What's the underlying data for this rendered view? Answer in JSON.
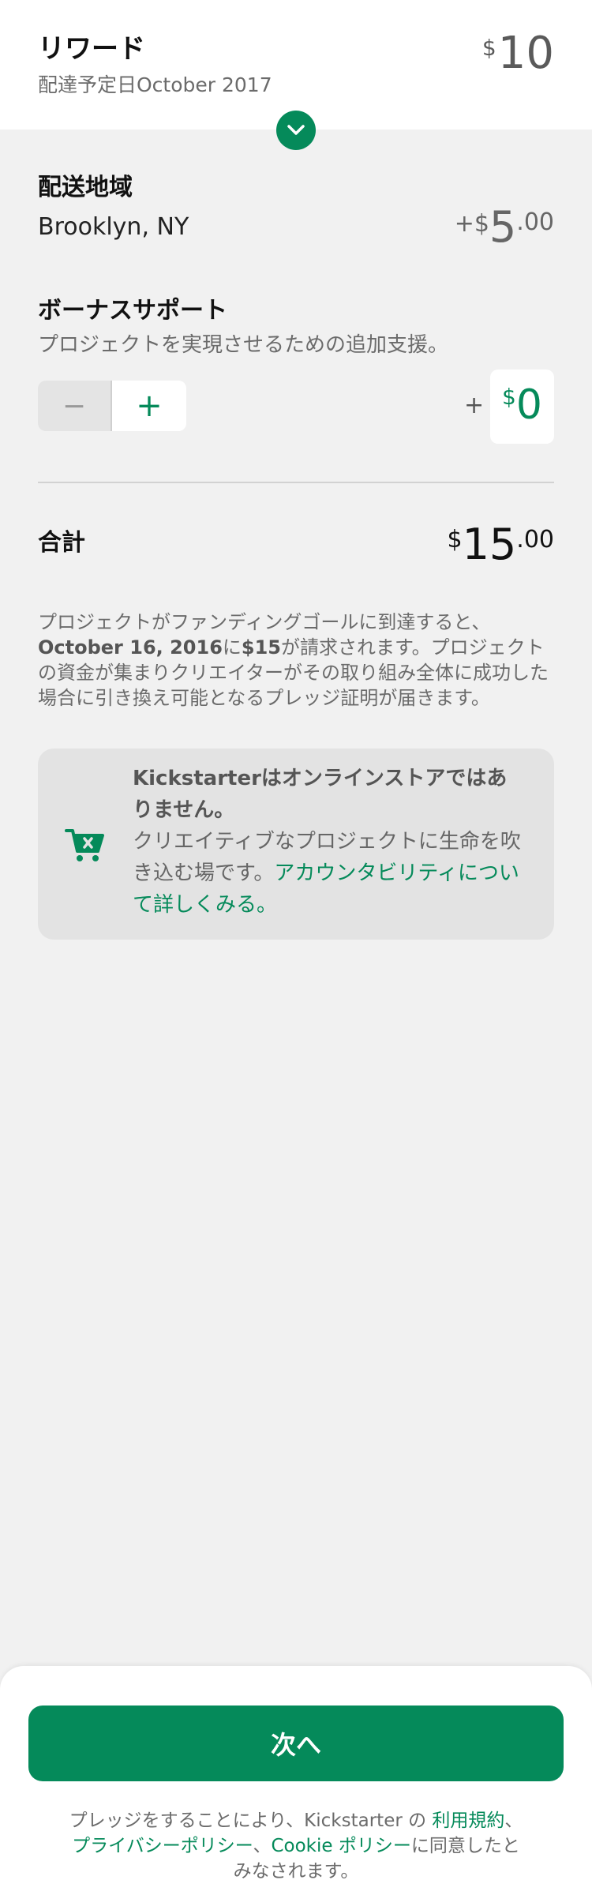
{
  "reward": {
    "title": "リワード",
    "delivery": "配達予定日October 2017",
    "currency": "$",
    "amount": "10"
  },
  "shipping": {
    "label": "配送地域",
    "location": "Brooklyn, NY",
    "price_prefix": "+$",
    "price": "5",
    "price_decimal": ".00"
  },
  "bonus": {
    "label": "ボーナスサポート",
    "description": "プロジェクトを実現させるための追加支援。",
    "minus_glyph": "−",
    "plus_glyph": "+",
    "prefix": "+",
    "currency": "$",
    "amount": "0"
  },
  "total": {
    "label": "合計",
    "currency": "$",
    "amount": "15",
    "decimal": ".00"
  },
  "charge_note": {
    "part1": "プロジェクトがファンディングゴールに到達すると、",
    "date": "October 16, 2016",
    "part2": "に",
    "amount": "$15",
    "part3": "が請求されます。プロジェクトの資金が集まりクリエイターがその取り組み全体に成功した場合に引き換え可能となるプレッジ証明が届きます。"
  },
  "info_box": {
    "heading": "Kickstarterはオンラインストアではありません。",
    "body": "クリエイティブなプロジェクトに生命を吹き込む場です。",
    "link": "アカウンタビリティについて詳しくみる。",
    "icon": "cart-icon"
  },
  "footer": {
    "next_label": "次へ",
    "legal_part1": "プレッジをすることにより、Kickstarter の ",
    "terms_link": "利用規約",
    "sep1": "、",
    "privacy_link": "プライバシーポリシー",
    "sep2": "、",
    "cookie_link": "Cookie ポリシー",
    "legal_part2": "に同意したとみなされます。"
  },
  "colors": {
    "accent": "#058a5a",
    "background": "#f1f1f1",
    "text_secondary": "#6b6b6b"
  }
}
